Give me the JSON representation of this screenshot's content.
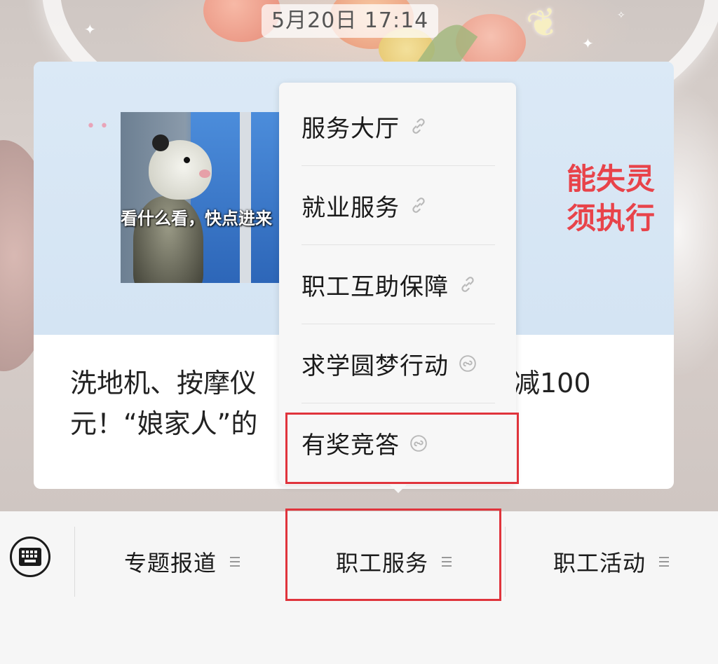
{
  "timestamp": "5月20日 17:14",
  "article": {
    "meme_caption": "看什么看，快点进来",
    "cover_headline_line1": "能失灵",
    "cover_headline_line2": "须执行",
    "title_line1": "洗地机、按摩仪",
    "title_line1_end": "减100",
    "title_line2": "元！“娘家人”的"
  },
  "popup_menu": {
    "items": [
      {
        "label": "服务大厅",
        "icon": "link-icon"
      },
      {
        "label": "就业服务",
        "icon": "link-icon"
      },
      {
        "label": "职工互助保障",
        "icon": "link-icon"
      },
      {
        "label": "求学圆梦行动",
        "icon": "mini-program-icon"
      },
      {
        "label": "有奖竞答",
        "icon": "mini-program-icon"
      }
    ]
  },
  "bottom_bar": {
    "keyboard_icon": "keyboard-icon",
    "tabs": [
      {
        "label": "专题报道",
        "icon": "menu-lines-icon"
      },
      {
        "label": "职工服务",
        "icon": "menu-lines-icon"
      },
      {
        "label": "职工活动",
        "icon": "menu-lines-icon"
      }
    ]
  },
  "colors": {
    "highlight": "#e0343c",
    "cover_headline": "#e8434a",
    "bar_background": "#f6f6f6",
    "menu_background": "#f7f7f7"
  }
}
